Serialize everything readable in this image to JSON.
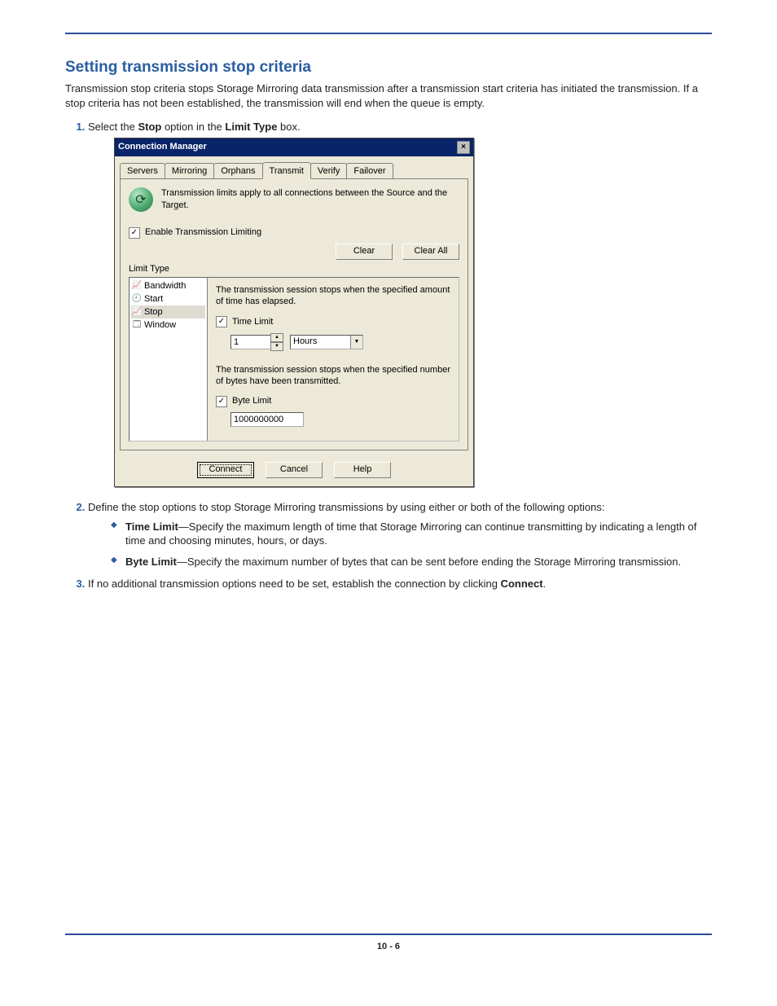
{
  "section": {
    "title": "Setting transmission stop criteria",
    "intro": "Transmission stop criteria stops Storage Mirroring data transmission after a transmission start criteria has initiated the transmission. If a stop criteria has not been established, the transmission will end when the queue is empty."
  },
  "steps": {
    "s1_pre": "Select the ",
    "s1_b1": "Stop",
    "s1_mid": " option in the ",
    "s1_b2": "Limit Type",
    "s1_post": " box.",
    "s2": "Define the stop options to stop Storage Mirroring transmissions by using either or both of the following options:",
    "s2a_b": "Time Limit",
    "s2a_t": "—Specify the maximum length of time that Storage Mirroring can continue transmitting by indicating a length of time and choosing minutes, hours, or days.",
    "s2b_b": "Byte Limit",
    "s2b_t": "—Specify the maximum number of bytes that can be sent before ending the Storage Mirroring transmission.",
    "s3_pre": "If no additional transmission options need to be set, establish the connection by clicking ",
    "s3_b": "Connect",
    "s3_post": "."
  },
  "dialog": {
    "title": "Connection Manager",
    "close": "×",
    "tabs": {
      "servers": "Servers",
      "mirroring": "Mirroring",
      "orphans": "Orphans",
      "transmit": "Transmit",
      "verify": "Verify",
      "failover": "Failover"
    },
    "info_text": "Transmission limits apply to all connections between the Source and the Target.",
    "enable_label": "Enable Transmission Limiting",
    "limit_type_label": "Limit Type",
    "clear": "Clear",
    "clear_all": "Clear All",
    "list": {
      "bandwidth": "Bandwidth",
      "start": "Start",
      "stop": "Stop",
      "window": "Window"
    },
    "detail": {
      "time_desc": "The transmission session stops when the specified amount of time has elapsed.",
      "time_label": "Time Limit",
      "time_value": "1",
      "time_unit": "Hours",
      "byte_desc": "The transmission session stops when the specified number of bytes have been transmitted.",
      "byte_label": "Byte Limit",
      "byte_value": "1000000000"
    },
    "footer": {
      "connect": "Connect",
      "cancel": "Cancel",
      "help": "Help"
    }
  },
  "footer": {
    "page": "10 - 6"
  }
}
